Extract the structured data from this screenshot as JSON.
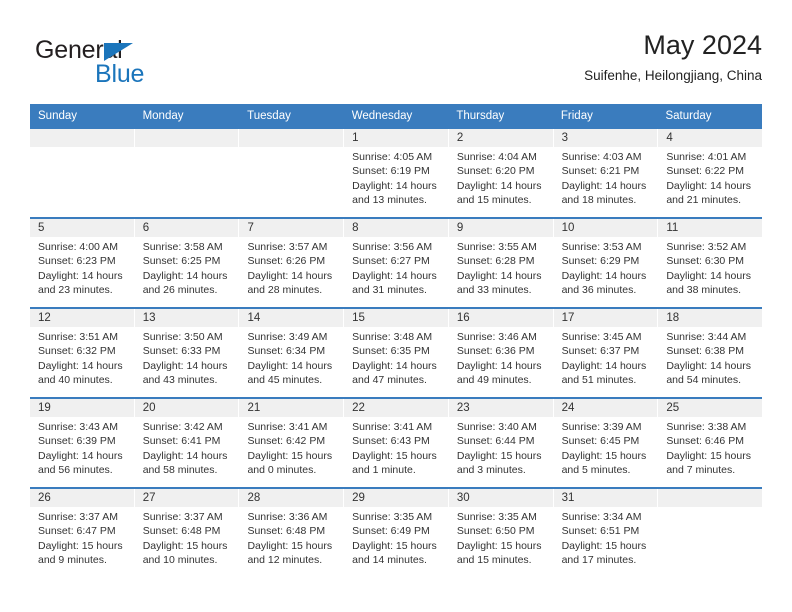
{
  "brand": {
    "name_part1": "General",
    "name_part2": "Blue",
    "triangle_color": "#1b75bb"
  },
  "header": {
    "title": "May 2024",
    "subtitle": "Suifenhe, Heilongjiang, China"
  },
  "theme": {
    "header_blue": "#3a7cbe",
    "band_gray": "#f0f0f0",
    "text": "#333333"
  },
  "calendar": {
    "weekdays": [
      "Sunday",
      "Monday",
      "Tuesday",
      "Wednesday",
      "Thursday",
      "Friday",
      "Saturday"
    ],
    "weeks": [
      [
        {
          "day": "",
          "sunrise": "",
          "sunset": "",
          "daylight1": "",
          "daylight2": ""
        },
        {
          "day": "",
          "sunrise": "",
          "sunset": "",
          "daylight1": "",
          "daylight2": ""
        },
        {
          "day": "",
          "sunrise": "",
          "sunset": "",
          "daylight1": "",
          "daylight2": ""
        },
        {
          "day": "1",
          "sunrise": "Sunrise: 4:05 AM",
          "sunset": "Sunset: 6:19 PM",
          "daylight1": "Daylight: 14 hours",
          "daylight2": "and 13 minutes."
        },
        {
          "day": "2",
          "sunrise": "Sunrise: 4:04 AM",
          "sunset": "Sunset: 6:20 PM",
          "daylight1": "Daylight: 14 hours",
          "daylight2": "and 15 minutes."
        },
        {
          "day": "3",
          "sunrise": "Sunrise: 4:03 AM",
          "sunset": "Sunset: 6:21 PM",
          "daylight1": "Daylight: 14 hours",
          "daylight2": "and 18 minutes."
        },
        {
          "day": "4",
          "sunrise": "Sunrise: 4:01 AM",
          "sunset": "Sunset: 6:22 PM",
          "daylight1": "Daylight: 14 hours",
          "daylight2": "and 21 minutes."
        }
      ],
      [
        {
          "day": "5",
          "sunrise": "Sunrise: 4:00 AM",
          "sunset": "Sunset: 6:23 PM",
          "daylight1": "Daylight: 14 hours",
          "daylight2": "and 23 minutes."
        },
        {
          "day": "6",
          "sunrise": "Sunrise: 3:58 AM",
          "sunset": "Sunset: 6:25 PM",
          "daylight1": "Daylight: 14 hours",
          "daylight2": "and 26 minutes."
        },
        {
          "day": "7",
          "sunrise": "Sunrise: 3:57 AM",
          "sunset": "Sunset: 6:26 PM",
          "daylight1": "Daylight: 14 hours",
          "daylight2": "and 28 minutes."
        },
        {
          "day": "8",
          "sunrise": "Sunrise: 3:56 AM",
          "sunset": "Sunset: 6:27 PM",
          "daylight1": "Daylight: 14 hours",
          "daylight2": "and 31 minutes."
        },
        {
          "day": "9",
          "sunrise": "Sunrise: 3:55 AM",
          "sunset": "Sunset: 6:28 PM",
          "daylight1": "Daylight: 14 hours",
          "daylight2": "and 33 minutes."
        },
        {
          "day": "10",
          "sunrise": "Sunrise: 3:53 AM",
          "sunset": "Sunset: 6:29 PM",
          "daylight1": "Daylight: 14 hours",
          "daylight2": "and 36 minutes."
        },
        {
          "day": "11",
          "sunrise": "Sunrise: 3:52 AM",
          "sunset": "Sunset: 6:30 PM",
          "daylight1": "Daylight: 14 hours",
          "daylight2": "and 38 minutes."
        }
      ],
      [
        {
          "day": "12",
          "sunrise": "Sunrise: 3:51 AM",
          "sunset": "Sunset: 6:32 PM",
          "daylight1": "Daylight: 14 hours",
          "daylight2": "and 40 minutes."
        },
        {
          "day": "13",
          "sunrise": "Sunrise: 3:50 AM",
          "sunset": "Sunset: 6:33 PM",
          "daylight1": "Daylight: 14 hours",
          "daylight2": "and 43 minutes."
        },
        {
          "day": "14",
          "sunrise": "Sunrise: 3:49 AM",
          "sunset": "Sunset: 6:34 PM",
          "daylight1": "Daylight: 14 hours",
          "daylight2": "and 45 minutes."
        },
        {
          "day": "15",
          "sunrise": "Sunrise: 3:48 AM",
          "sunset": "Sunset: 6:35 PM",
          "daylight1": "Daylight: 14 hours",
          "daylight2": "and 47 minutes."
        },
        {
          "day": "16",
          "sunrise": "Sunrise: 3:46 AM",
          "sunset": "Sunset: 6:36 PM",
          "daylight1": "Daylight: 14 hours",
          "daylight2": "and 49 minutes."
        },
        {
          "day": "17",
          "sunrise": "Sunrise: 3:45 AM",
          "sunset": "Sunset: 6:37 PM",
          "daylight1": "Daylight: 14 hours",
          "daylight2": "and 51 minutes."
        },
        {
          "day": "18",
          "sunrise": "Sunrise: 3:44 AM",
          "sunset": "Sunset: 6:38 PM",
          "daylight1": "Daylight: 14 hours",
          "daylight2": "and 54 minutes."
        }
      ],
      [
        {
          "day": "19",
          "sunrise": "Sunrise: 3:43 AM",
          "sunset": "Sunset: 6:39 PM",
          "daylight1": "Daylight: 14 hours",
          "daylight2": "and 56 minutes."
        },
        {
          "day": "20",
          "sunrise": "Sunrise: 3:42 AM",
          "sunset": "Sunset: 6:41 PM",
          "daylight1": "Daylight: 14 hours",
          "daylight2": "and 58 minutes."
        },
        {
          "day": "21",
          "sunrise": "Sunrise: 3:41 AM",
          "sunset": "Sunset: 6:42 PM",
          "daylight1": "Daylight: 15 hours",
          "daylight2": "and 0 minutes."
        },
        {
          "day": "22",
          "sunrise": "Sunrise: 3:41 AM",
          "sunset": "Sunset: 6:43 PM",
          "daylight1": "Daylight: 15 hours",
          "daylight2": "and 1 minute."
        },
        {
          "day": "23",
          "sunrise": "Sunrise: 3:40 AM",
          "sunset": "Sunset: 6:44 PM",
          "daylight1": "Daylight: 15 hours",
          "daylight2": "and 3 minutes."
        },
        {
          "day": "24",
          "sunrise": "Sunrise: 3:39 AM",
          "sunset": "Sunset: 6:45 PM",
          "daylight1": "Daylight: 15 hours",
          "daylight2": "and 5 minutes."
        },
        {
          "day": "25",
          "sunrise": "Sunrise: 3:38 AM",
          "sunset": "Sunset: 6:46 PM",
          "daylight1": "Daylight: 15 hours",
          "daylight2": "and 7 minutes."
        }
      ],
      [
        {
          "day": "26",
          "sunrise": "Sunrise: 3:37 AM",
          "sunset": "Sunset: 6:47 PM",
          "daylight1": "Daylight: 15 hours",
          "daylight2": "and 9 minutes."
        },
        {
          "day": "27",
          "sunrise": "Sunrise: 3:37 AM",
          "sunset": "Sunset: 6:48 PM",
          "daylight1": "Daylight: 15 hours",
          "daylight2": "and 10 minutes."
        },
        {
          "day": "28",
          "sunrise": "Sunrise: 3:36 AM",
          "sunset": "Sunset: 6:48 PM",
          "daylight1": "Daylight: 15 hours",
          "daylight2": "and 12 minutes."
        },
        {
          "day": "29",
          "sunrise": "Sunrise: 3:35 AM",
          "sunset": "Sunset: 6:49 PM",
          "daylight1": "Daylight: 15 hours",
          "daylight2": "and 14 minutes."
        },
        {
          "day": "30",
          "sunrise": "Sunrise: 3:35 AM",
          "sunset": "Sunset: 6:50 PM",
          "daylight1": "Daylight: 15 hours",
          "daylight2": "and 15 minutes."
        },
        {
          "day": "31",
          "sunrise": "Sunrise: 3:34 AM",
          "sunset": "Sunset: 6:51 PM",
          "daylight1": "Daylight: 15 hours",
          "daylight2": "and 17 minutes."
        },
        {
          "day": "",
          "sunrise": "",
          "sunset": "",
          "daylight1": "",
          "daylight2": ""
        }
      ]
    ]
  }
}
